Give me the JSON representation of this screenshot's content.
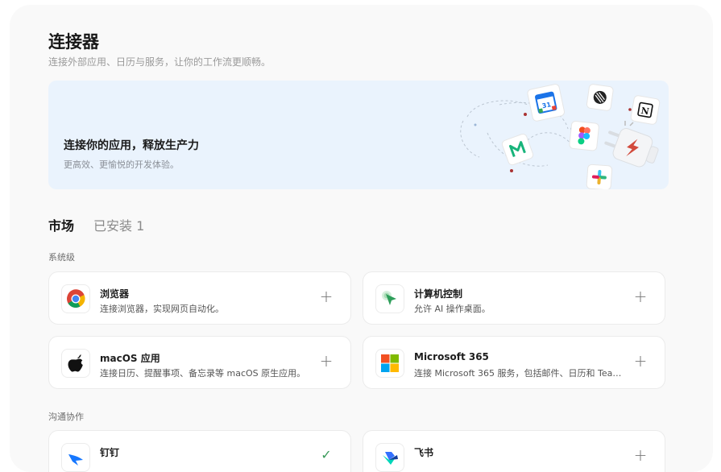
{
  "page": {
    "title": "连接器",
    "subtitle": "连接外部应用、日历与服务，让你的工作流更顺畅。"
  },
  "banner": {
    "title": "连接你的应用，释放生产力",
    "subtitle": "更高效、更愉悦的开发体验。",
    "calendar_number": "31"
  },
  "tabs": [
    {
      "label": "市场",
      "active": true
    },
    {
      "label": "已安装 1",
      "active": false
    }
  ],
  "sections": {
    "system": "系统级",
    "communication": "沟通协作"
  },
  "cards": {
    "browser": {
      "title": "浏览器",
      "desc": "连接浏览器，实现网页自动化。",
      "action": "+"
    },
    "computer": {
      "title": "计算机控制",
      "desc": "允许 AI 操作桌面。",
      "action": "+"
    },
    "macos": {
      "title": "macOS 应用",
      "desc": "连接日历、提醒事项、备忘录等 macOS 原生应用。",
      "action": "+"
    },
    "microsoft": {
      "title": "Microsoft 365",
      "desc": "连接 Microsoft 365 服务，包括邮件、日历和 Tea…",
      "action": "+"
    },
    "dingtalk": {
      "title": "钉钉",
      "desc": "",
      "action": "✓"
    },
    "feishu": {
      "title": "飞书",
      "desc": "",
      "action": "+"
    }
  },
  "colors": {
    "panel_bg": "#f9f9f9",
    "banner_bg": "#eaf3fd",
    "card_border": "#ebebeb"
  }
}
